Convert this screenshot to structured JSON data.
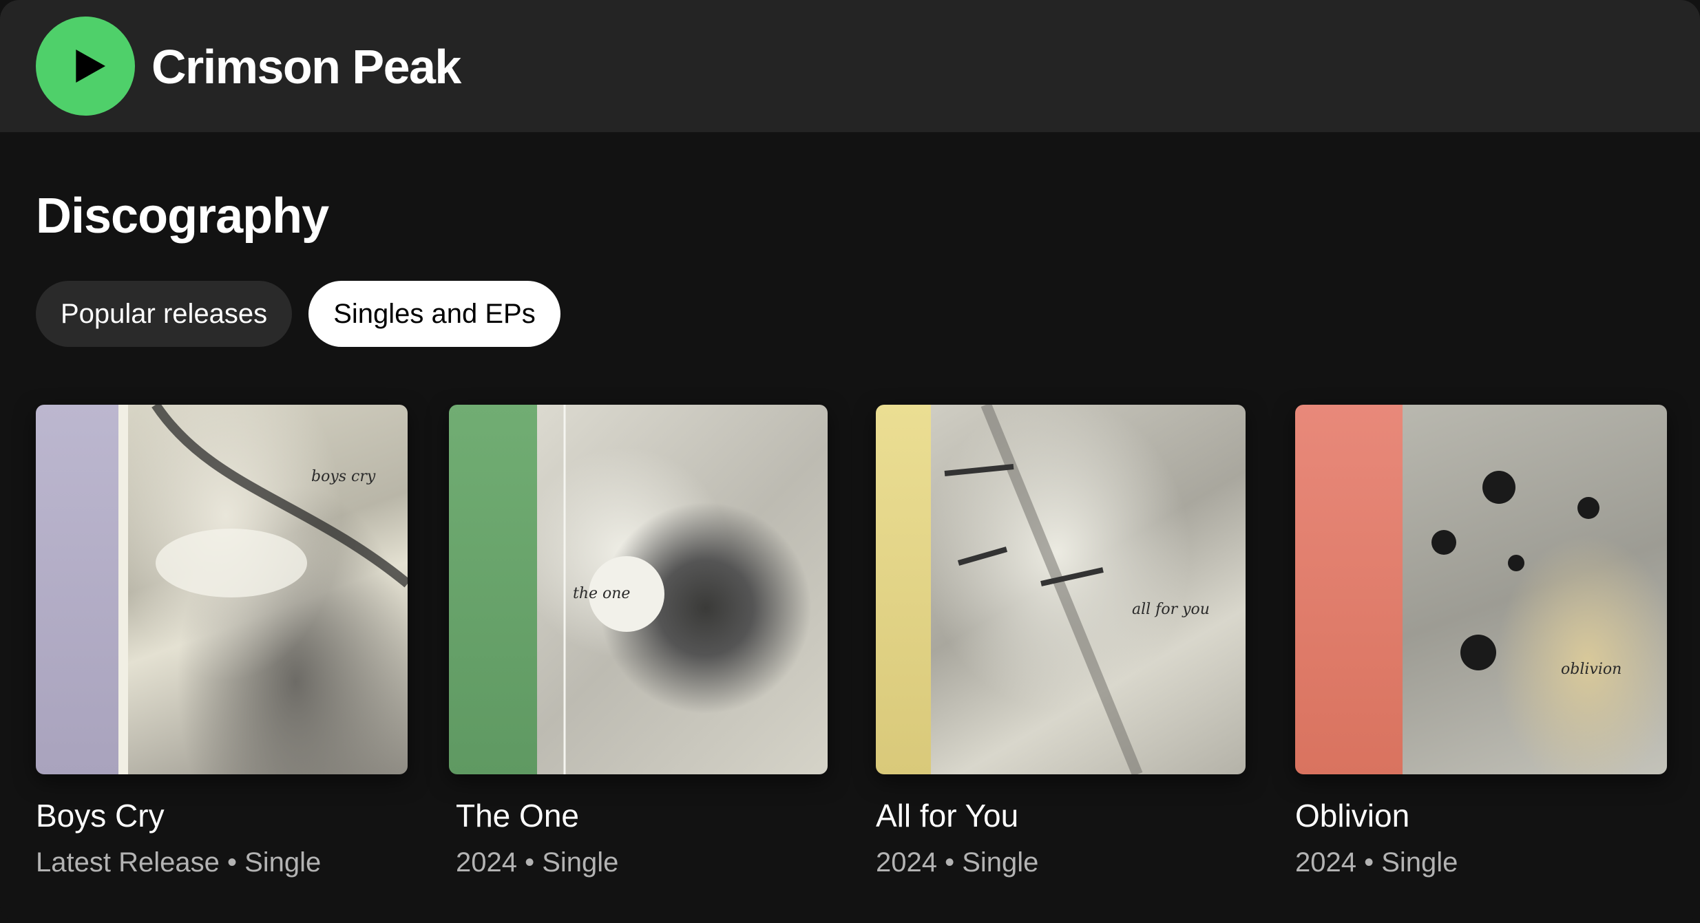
{
  "header": {
    "artist_name": "Crimson Peak",
    "play_icon": "play-icon",
    "play_color": "#4fd06a"
  },
  "section": {
    "title": "Discography",
    "chips": [
      {
        "label": "Popular releases",
        "active": false
      },
      {
        "label": "Singles and EPs",
        "active": true
      }
    ]
  },
  "releases": [
    {
      "title": "Boys Cry",
      "subtitle": "Latest Release • Single",
      "cover_script": "boys cry",
      "spine_color": "#b9b4cc"
    },
    {
      "title": "The One",
      "subtitle": "2024 • Single",
      "cover_script": "the one",
      "spine_color": "#6aa86e"
    },
    {
      "title": "All for You",
      "subtitle": "2024 • Single",
      "cover_script": "all for you",
      "spine_color": "#e6d88c"
    },
    {
      "title": "Oblivion",
      "subtitle": "2024 • Single",
      "cover_script": "oblivion",
      "spine_color": "#e58475"
    }
  ]
}
